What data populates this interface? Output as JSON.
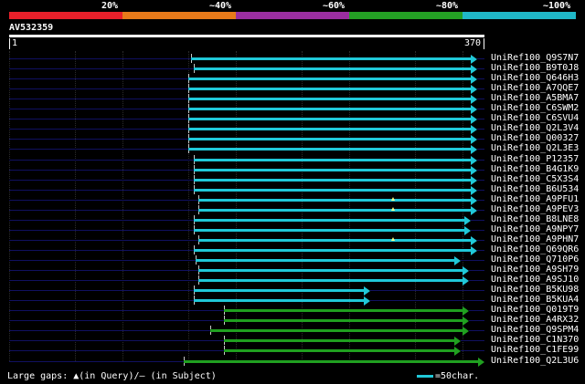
{
  "coverage_scale": {
    "labels": [
      "20%",
      "~40%",
      "~60%",
      "~80%",
      "~100%"
    ],
    "colors": [
      "#e8202a",
      "#e87a1a",
      "#9a2ea0",
      "#24a024",
      "#20b8c8"
    ]
  },
  "query": {
    "name": "AV532359",
    "start": "1",
    "end": "370"
  },
  "hits": [
    {
      "label": "UniRef100_Q9S7N7",
      "start": 0.383,
      "end": 0.985,
      "color": "cyan",
      "gaps": []
    },
    {
      "label": "UniRef100_B9T0J8",
      "start": 0.389,
      "end": 0.985,
      "color": "cyan",
      "gaps": []
    },
    {
      "label": "UniRef100_Q646H3",
      "start": 0.377,
      "end": 0.985,
      "color": "cyan",
      "gaps": []
    },
    {
      "label": "UniRef100_A7QQE7",
      "start": 0.377,
      "end": 0.985,
      "color": "cyan",
      "gaps": []
    },
    {
      "label": "UniRef100_A5BMA7",
      "start": 0.377,
      "end": 0.985,
      "color": "cyan",
      "gaps": []
    },
    {
      "label": "UniRef100_C6SWM2",
      "start": 0.377,
      "end": 0.985,
      "color": "cyan",
      "gaps": []
    },
    {
      "label": "UniRef100_C6SVU4",
      "start": 0.377,
      "end": 0.985,
      "color": "cyan",
      "gaps": []
    },
    {
      "label": "UniRef100_Q2L3V4",
      "start": 0.377,
      "end": 0.985,
      "color": "cyan",
      "gaps": []
    },
    {
      "label": "UniRef100_Q00327",
      "start": 0.377,
      "end": 0.985,
      "color": "cyan",
      "gaps": []
    },
    {
      "label": "UniRef100_Q2L3E3",
      "start": 0.377,
      "end": 0.985,
      "color": "cyan",
      "gaps": []
    },
    {
      "label": "UniRef100_P12357",
      "start": 0.389,
      "end": 0.985,
      "color": "cyan",
      "gaps": []
    },
    {
      "label": "UniRef100_B4G1K9",
      "start": 0.389,
      "end": 0.985,
      "color": "cyan",
      "gaps": []
    },
    {
      "label": "UniRef100_C5X3S4",
      "start": 0.389,
      "end": 0.985,
      "color": "cyan",
      "gaps": []
    },
    {
      "label": "UniRef100_B6U534",
      "start": 0.389,
      "end": 0.985,
      "color": "cyan",
      "gaps": []
    },
    {
      "label": "UniRef100_A9PFU1",
      "start": 0.398,
      "end": 0.985,
      "color": "cyan",
      "gaps": [
        0.808
      ]
    },
    {
      "label": "UniRef100_A9PEV3",
      "start": 0.398,
      "end": 0.985,
      "color": "cyan",
      "gaps": [
        0.808
      ]
    },
    {
      "label": "UniRef100_B8LNE8",
      "start": 0.389,
      "end": 0.972,
      "color": "cyan",
      "gaps": []
    },
    {
      "label": "UniRef100_A9NPY7",
      "start": 0.389,
      "end": 0.972,
      "color": "cyan",
      "gaps": []
    },
    {
      "label": "UniRef100_A9PHN7",
      "start": 0.398,
      "end": 0.985,
      "color": "cyan",
      "gaps": [
        0.808
      ]
    },
    {
      "label": "UniRef100_Q69QR6",
      "start": 0.389,
      "end": 0.985,
      "color": "cyan",
      "gaps": []
    },
    {
      "label": "UniRef100_Q710P6",
      "start": 0.392,
      "end": 0.95,
      "color": "cyan",
      "gaps": []
    },
    {
      "label": "UniRef100_A9SH79",
      "start": 0.398,
      "end": 0.967,
      "color": "cyan",
      "gaps": []
    },
    {
      "label": "UniRef100_A9SJ10",
      "start": 0.398,
      "end": 0.967,
      "color": "cyan",
      "gaps": []
    },
    {
      "label": "UniRef100_B5KU98",
      "start": 0.389,
      "end": 0.76,
      "color": "cyan",
      "gaps": []
    },
    {
      "label": "UniRef100_B5KUA4",
      "start": 0.389,
      "end": 0.76,
      "color": "cyan",
      "gaps": []
    },
    {
      "label": "UniRef100_Q019T9",
      "start": 0.452,
      "end": 0.967,
      "color": "green",
      "gaps": []
    },
    {
      "label": "UniRef100_A4RX32",
      "start": 0.452,
      "end": 0.967,
      "color": "green",
      "gaps": []
    },
    {
      "label": "UniRef100_Q9SPM4",
      "start": 0.423,
      "end": 0.967,
      "color": "green",
      "gaps": []
    },
    {
      "label": "UniRef100_C1N370",
      "start": 0.452,
      "end": 0.95,
      "color": "green",
      "gaps": []
    },
    {
      "label": "UniRef100_C1FE99",
      "start": 0.452,
      "end": 0.95,
      "color": "green",
      "gaps": []
    },
    {
      "label": "UniRef100_Q2L3U6",
      "start": 0.367,
      "end": 1.0,
      "color": "green",
      "gaps": []
    }
  ],
  "legend": {
    "gaps_text": "Large gaps: ▲(in Query)/– (in Subject)",
    "scale_text": "=50char."
  }
}
